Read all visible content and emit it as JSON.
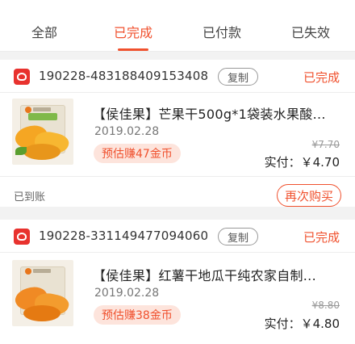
{
  "tabs": [
    {
      "label": "全部",
      "active": false
    },
    {
      "label": "已完成",
      "active": true
    },
    {
      "label": "已付款",
      "active": false
    },
    {
      "label": "已失效",
      "active": false
    }
  ],
  "colors": {
    "accent": "#f0512e",
    "earn_bg": "#fde4dc",
    "store_logo": "#e8322e"
  },
  "orders": [
    {
      "store_icon": "store-logo-icon",
      "order_no": "190228-483188409153408",
      "copy_label": "复制",
      "status": "已完成",
      "product_image": "dried-mango-package",
      "title": "【侯佳果】芒果干500g*1袋装水果酸...",
      "date": "2019.02.28",
      "earn": "预估赚47金币",
      "original_price": "¥7.70",
      "paid": "实付：￥4.70",
      "settled": "已到账",
      "rebuy_label": "再次购买"
    },
    {
      "store_icon": "store-logo-icon",
      "order_no": "190228-331149477094060",
      "copy_label": "复制",
      "status": "已完成",
      "product_image": "dried-sweet-potato-package",
      "title": "【侯佳果】红薯干地瓜干纯农家自制...",
      "date": "2019.02.28",
      "earn": "预估赚38金币",
      "original_price": "¥8.80",
      "paid": "实付：￥4.80"
    }
  ]
}
